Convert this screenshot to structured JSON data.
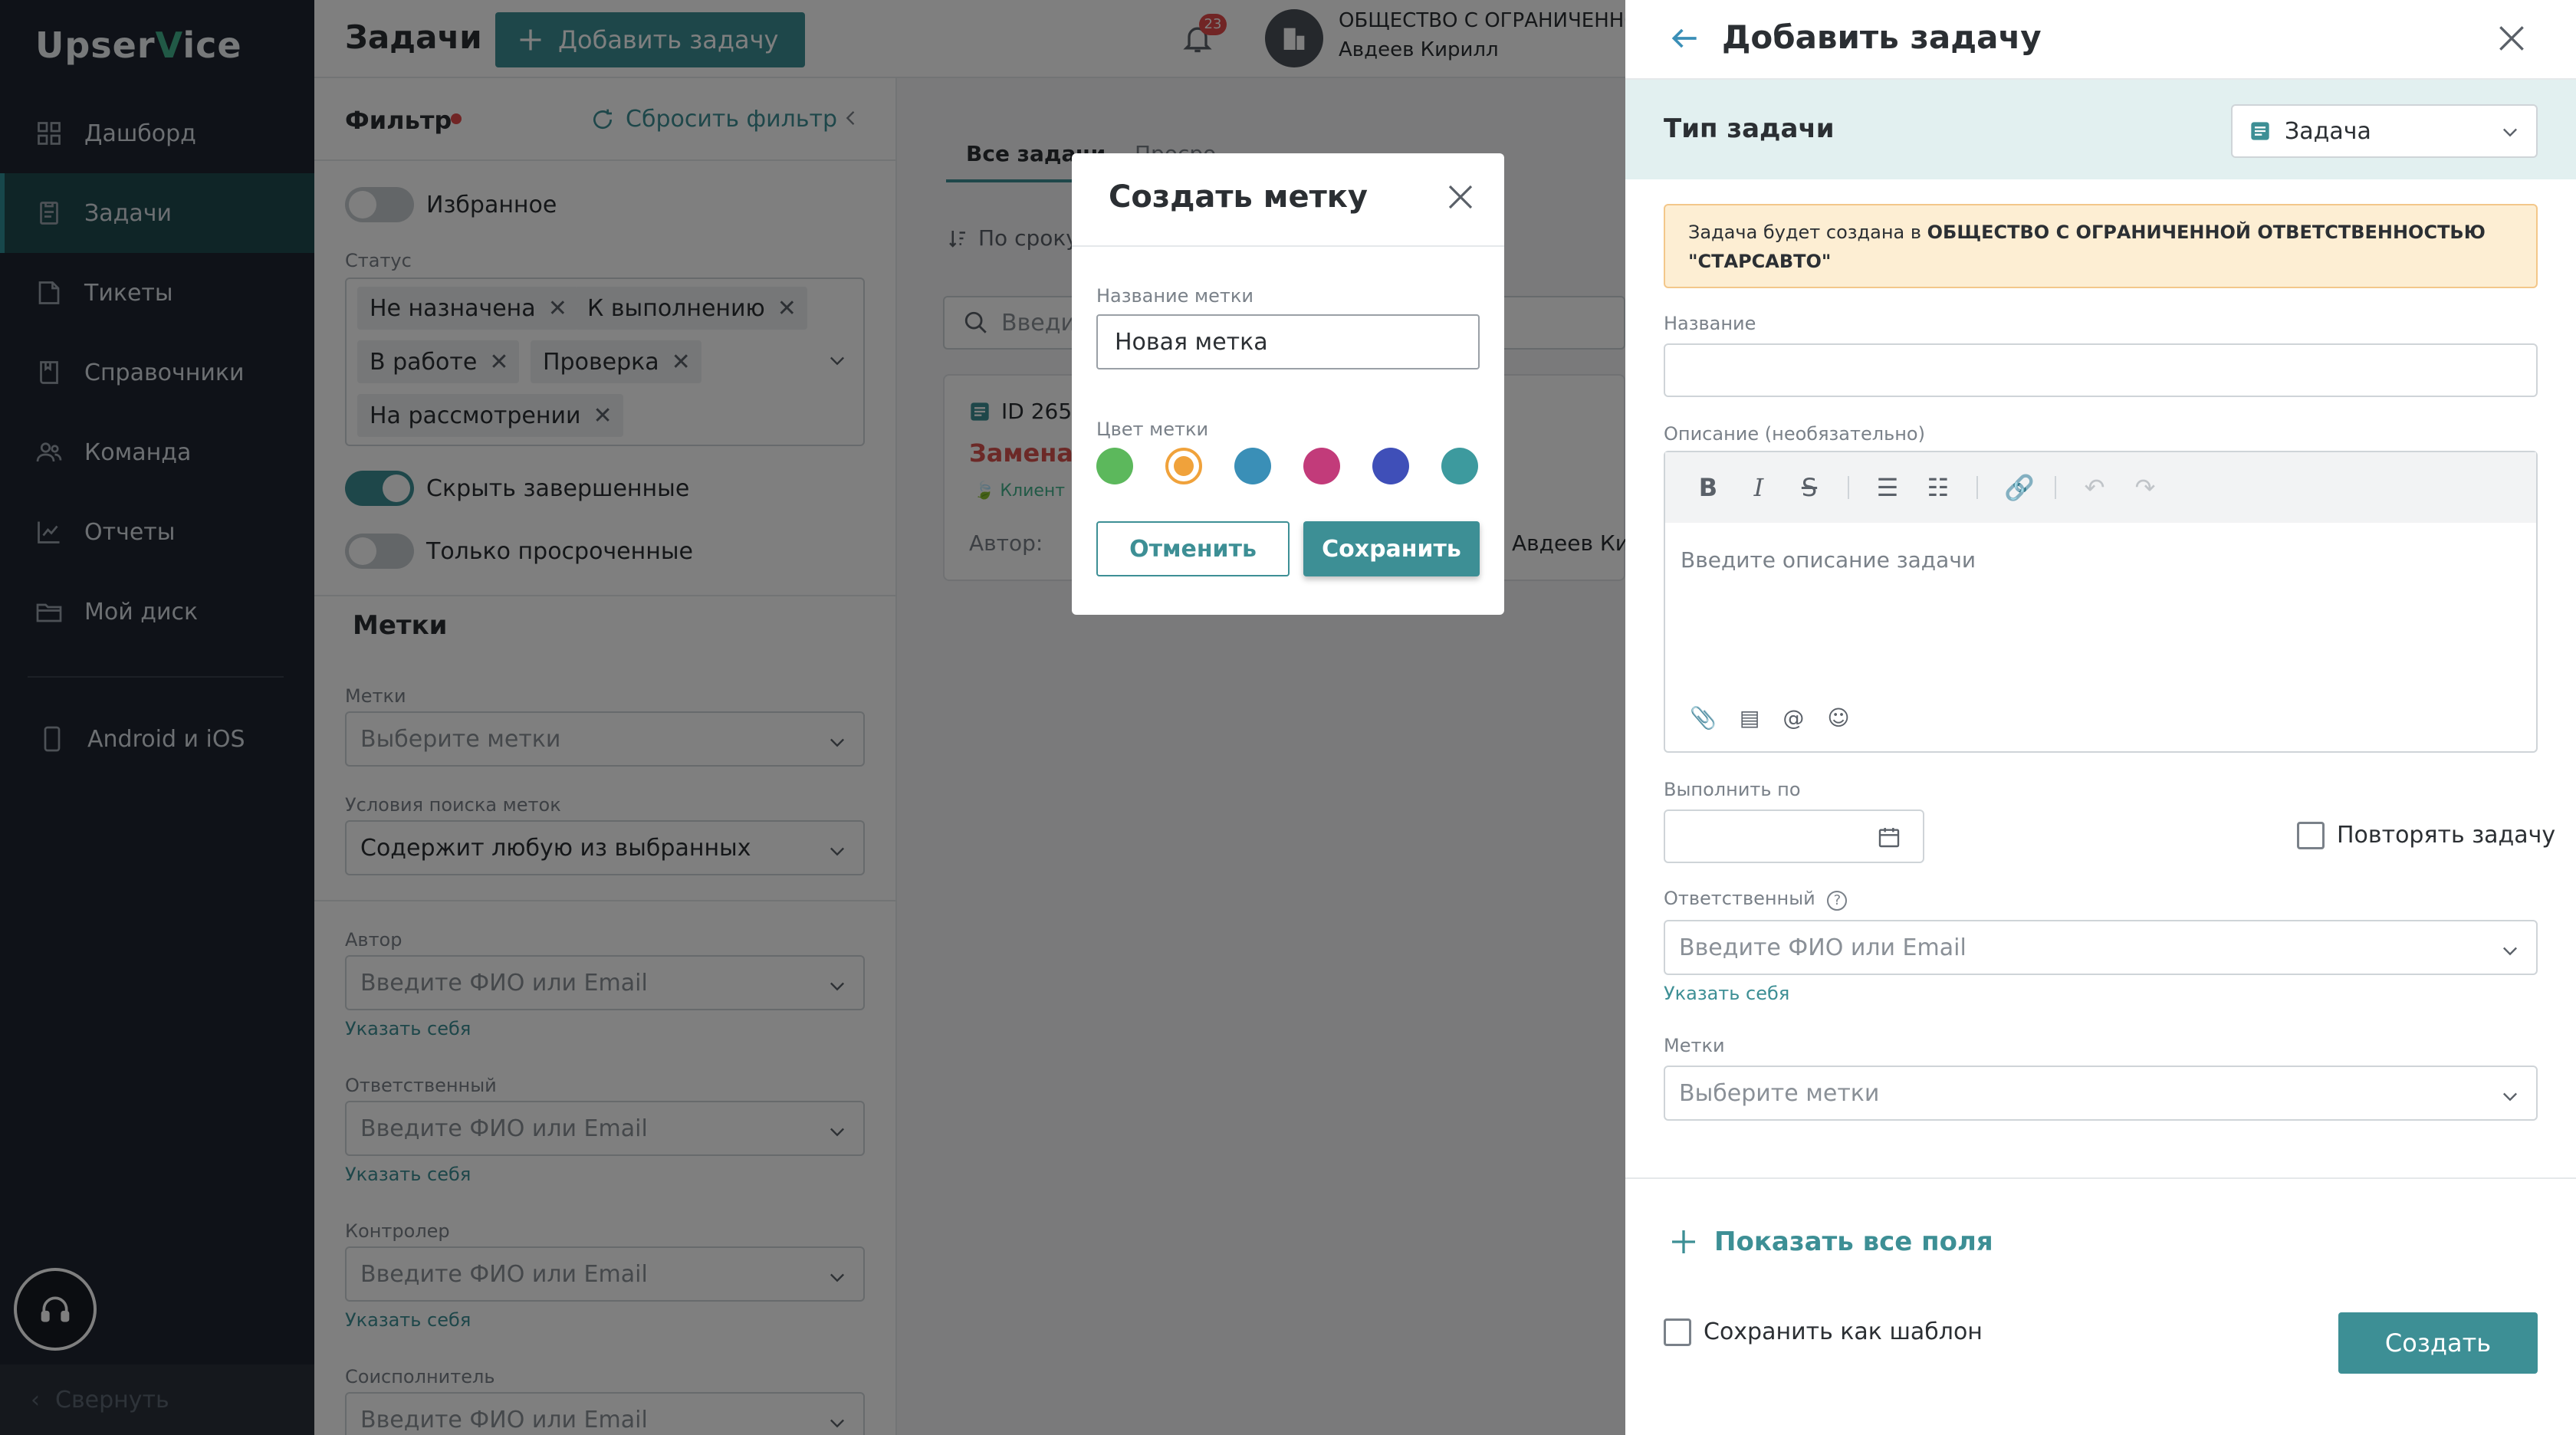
{
  "app": {
    "logo_prefix": "Upser",
    "logo_v": "V",
    "logo_suffix": "ice"
  },
  "sidebar": {
    "items": [
      {
        "label": "Дашборд",
        "icon": "grid-icon"
      },
      {
        "label": "Задачи",
        "icon": "tasks-icon",
        "active": true
      },
      {
        "label": "Тикеты",
        "icon": "ticket-icon"
      },
      {
        "label": "Справочники",
        "icon": "book-icon"
      },
      {
        "label": "Команда",
        "icon": "team-icon"
      },
      {
        "label": "Отчеты",
        "icon": "chart-icon"
      },
      {
        "label": "Мой диск",
        "icon": "folder-icon"
      }
    ],
    "mobile": "Android и iOS",
    "collapse": "Свернуть"
  },
  "header": {
    "title": "Задачи",
    "add_task": "Добавить задачу",
    "notifications_count": "23",
    "org_name": "ОБЩЕСТВО С ОГРАНИЧЕННОЙ ОТВЕТСТВЕННОСТЬЮ",
    "user_name": "Авдеев Кирилл"
  },
  "filter": {
    "title": "Фильтр",
    "reset": "Сбросить фильтр",
    "favorites": "Избранное",
    "status_label": "Статус",
    "status_chips": [
      "Не назначена",
      "К выполнению",
      "В работе",
      "Проверка",
      "На рассмотрении"
    ],
    "hide_completed": "Скрыть завершенные",
    "only_overdue": "Только просроченные",
    "tags_section": "Метки",
    "tags_label": "Метки",
    "tags_placeholder": "Выберите метки",
    "tags_condition_label": "Условия поиска меток",
    "tags_condition_value": "Содержит любую из выбранных",
    "author_label": "Автор",
    "author_placeholder": "Введите ФИО или Email",
    "assign_self": "Указать себя",
    "responsible_label": "Ответственный",
    "responsible_placeholder": "Введите ФИО или Email",
    "controller_label": "Контролер",
    "controller_placeholder": "Введите ФИО или Email",
    "coexecutor_label": "Соисполнитель",
    "coexecutor_placeholder": "Введите ФИО или Email"
  },
  "tasks": {
    "tab_all": "Все задачи",
    "tab_other": "Просро",
    "sort": "По сроку",
    "search_placeholder": "Введит",
    "card": {
      "id": "ID 265",
      "name": "Замена",
      "client": "Клиент",
      "author_label": "Автор:",
      "author_name": "Авдеев Кир"
    }
  },
  "modal": {
    "title": "Создать метку",
    "name_label": "Название метки",
    "name_value": "Новая метка",
    "color_label": "Цвет метки",
    "colors": [
      "#5cb85c",
      "#f0a23b",
      "#3a8fb7",
      "#c23b7a",
      "#3f4fb8",
      "#3d9a9e"
    ],
    "selected_color_index": 1,
    "cancel": "Отменить",
    "save": "Сохранить"
  },
  "drawer": {
    "title": "Добавить задачу",
    "type_label": "Тип задачи",
    "type_value": "Задача",
    "notice_prefix": "Задача будет создана в ",
    "notice_org": "ОБЩЕСТВО С ОГРАНИЧЕННОЙ ОТВЕТСТВЕННОСТЬЮ \"СТАРСАВТО\"",
    "name_label": "Название",
    "desc_label": "Описание (необязательно)",
    "desc_placeholder": "Введите описание задачи",
    "due_label": "Выполнить по",
    "repeat": "Повторять задачу",
    "responsible_label": "Ответственный",
    "responsible_placeholder": "Введите ФИО или Email",
    "assign_self": "Указать себя",
    "tags_label": "Метки",
    "tags_placeholder": "Выберите метки",
    "show_all": "Показать все поля",
    "save_template": "Сохранить как шаблон",
    "create": "Создать"
  },
  "colors": {
    "accent": "#3d8f95",
    "sidebar_bg": "#1e2530",
    "danger": "#e24b4b"
  }
}
